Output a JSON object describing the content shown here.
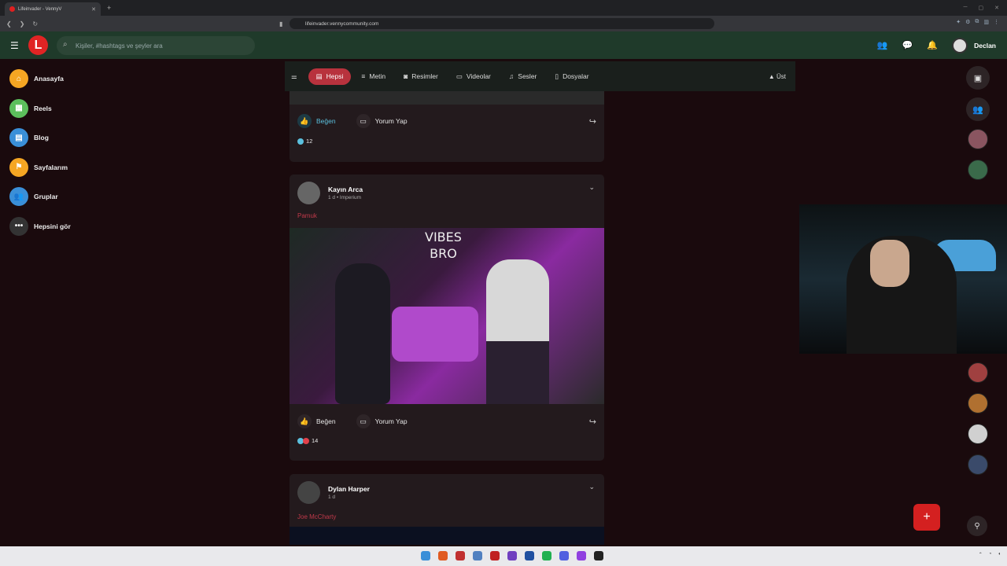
{
  "browser": {
    "tab_title": "Lifeinvader - VennyV",
    "url": "lifeinvader.vennycommunity.com"
  },
  "header": {
    "search_placeholder": "Kişiler, #hashtags ve şeyler ara",
    "user_name": "Declan"
  },
  "sidebar": {
    "items": [
      {
        "label": "Anasayfa",
        "color": "#f5a623"
      },
      {
        "label": "Reels",
        "color": "#5cbf5c"
      },
      {
        "label": "Blog",
        "color": "#3a8fd8"
      },
      {
        "label": "Sayfalarım",
        "color": "#f5a623"
      },
      {
        "label": "Gruplar",
        "color": "#3a8fd8"
      },
      {
        "label": "Hepsini gör",
        "color": "#444"
      }
    ]
  },
  "filters": {
    "items": [
      "Hepsi",
      "Metin",
      "Resimler",
      "Videolar",
      "Sesler",
      "Dosyalar"
    ],
    "top_label": "Üst"
  },
  "posts": [
    {
      "like_label": "Beğen",
      "comment_label": "Yorum Yap",
      "likes": "12"
    },
    {
      "author": "Kayın Arca",
      "meta": "1 d • Imperium",
      "tag": "Pamuk",
      "image_text": "VIBES\nBRO",
      "like_label": "Beğen",
      "comment_label": "Yorum Yap",
      "likes": "14"
    },
    {
      "author": "Dylan Harper",
      "meta": "1 d",
      "tag": "Joe McCharty"
    }
  ],
  "colors": {
    "accent": "#b8323d",
    "appbar": "#1f3a2a",
    "background": "#1a0a0d"
  }
}
